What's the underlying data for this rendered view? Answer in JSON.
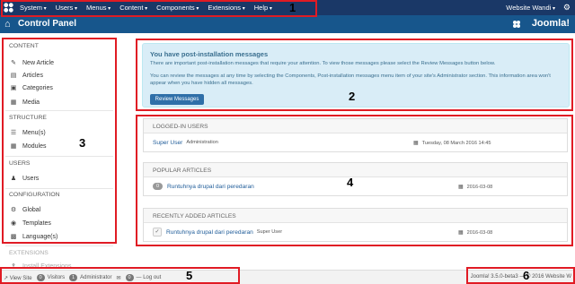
{
  "topnav": {
    "menus": [
      "System",
      "Users",
      "Menus",
      "Content",
      "Components",
      "Extensions",
      "Help"
    ],
    "site_name": "Website Wandi",
    "settings_icon": "gear-icon"
  },
  "titlebar": {
    "title": "Control Panel",
    "brand": "Joomla!"
  },
  "sidebar": {
    "sections": {
      "content": "CONTENT",
      "structure": "STRUCTURE",
      "users": "USERS",
      "configuration": "CONFIGURATION",
      "extensions": "EXTENSIONS"
    },
    "items": {
      "new_article": "New Article",
      "articles": "Articles",
      "categories": "Categories",
      "media": "Media",
      "menus": "Menu(s)",
      "modules": "Modules",
      "users": "Users",
      "global": "Global",
      "templates": "Templates",
      "languages": "Language(s)",
      "install_extensions": "Install Extensions"
    }
  },
  "message": {
    "heading": "You have post-installation messages",
    "line1": "There are important post-installation messages that require your attention. To view those messages please select the Review Messages button below.",
    "line2": "You can review the messages at any time by selecting the Components, Post-installation messages menu item of your site's Administrator section. This information area won't appear when you have hidden all messages.",
    "button": "Review Messages"
  },
  "logged_in": {
    "header": "LOGGED-IN USERS",
    "user": "Super User",
    "role": "Administration",
    "date": "Tuesday, 08 March 2016 14:45"
  },
  "popular": {
    "header": "POPULAR ARTICLES",
    "hits": "0",
    "title": "Runtuhnya drupal dari peredaran",
    "date": "2016-03-08"
  },
  "recent": {
    "header": "RECENTLY ADDED ARTICLES",
    "title": "Runtuhnya drupal dari peredaran",
    "author": "Super User",
    "date": "2016-03-08"
  },
  "footer": {
    "view_site": "View Site",
    "visitors_count": "0",
    "visitors": "Visitors",
    "admin_count": "1",
    "admin": "Administrator",
    "msg_count": "0",
    "logout": "Log out",
    "version": "Joomla! 3.5.0-beta3 — © 2016 Website W"
  },
  "annotations": [
    "1",
    "2",
    "3",
    "4",
    "5",
    "6"
  ],
  "colors": {
    "topnav": "#1a3867",
    "titlebar": "#17568c",
    "annotation": "#e01b24",
    "info": "#d9edf7"
  }
}
